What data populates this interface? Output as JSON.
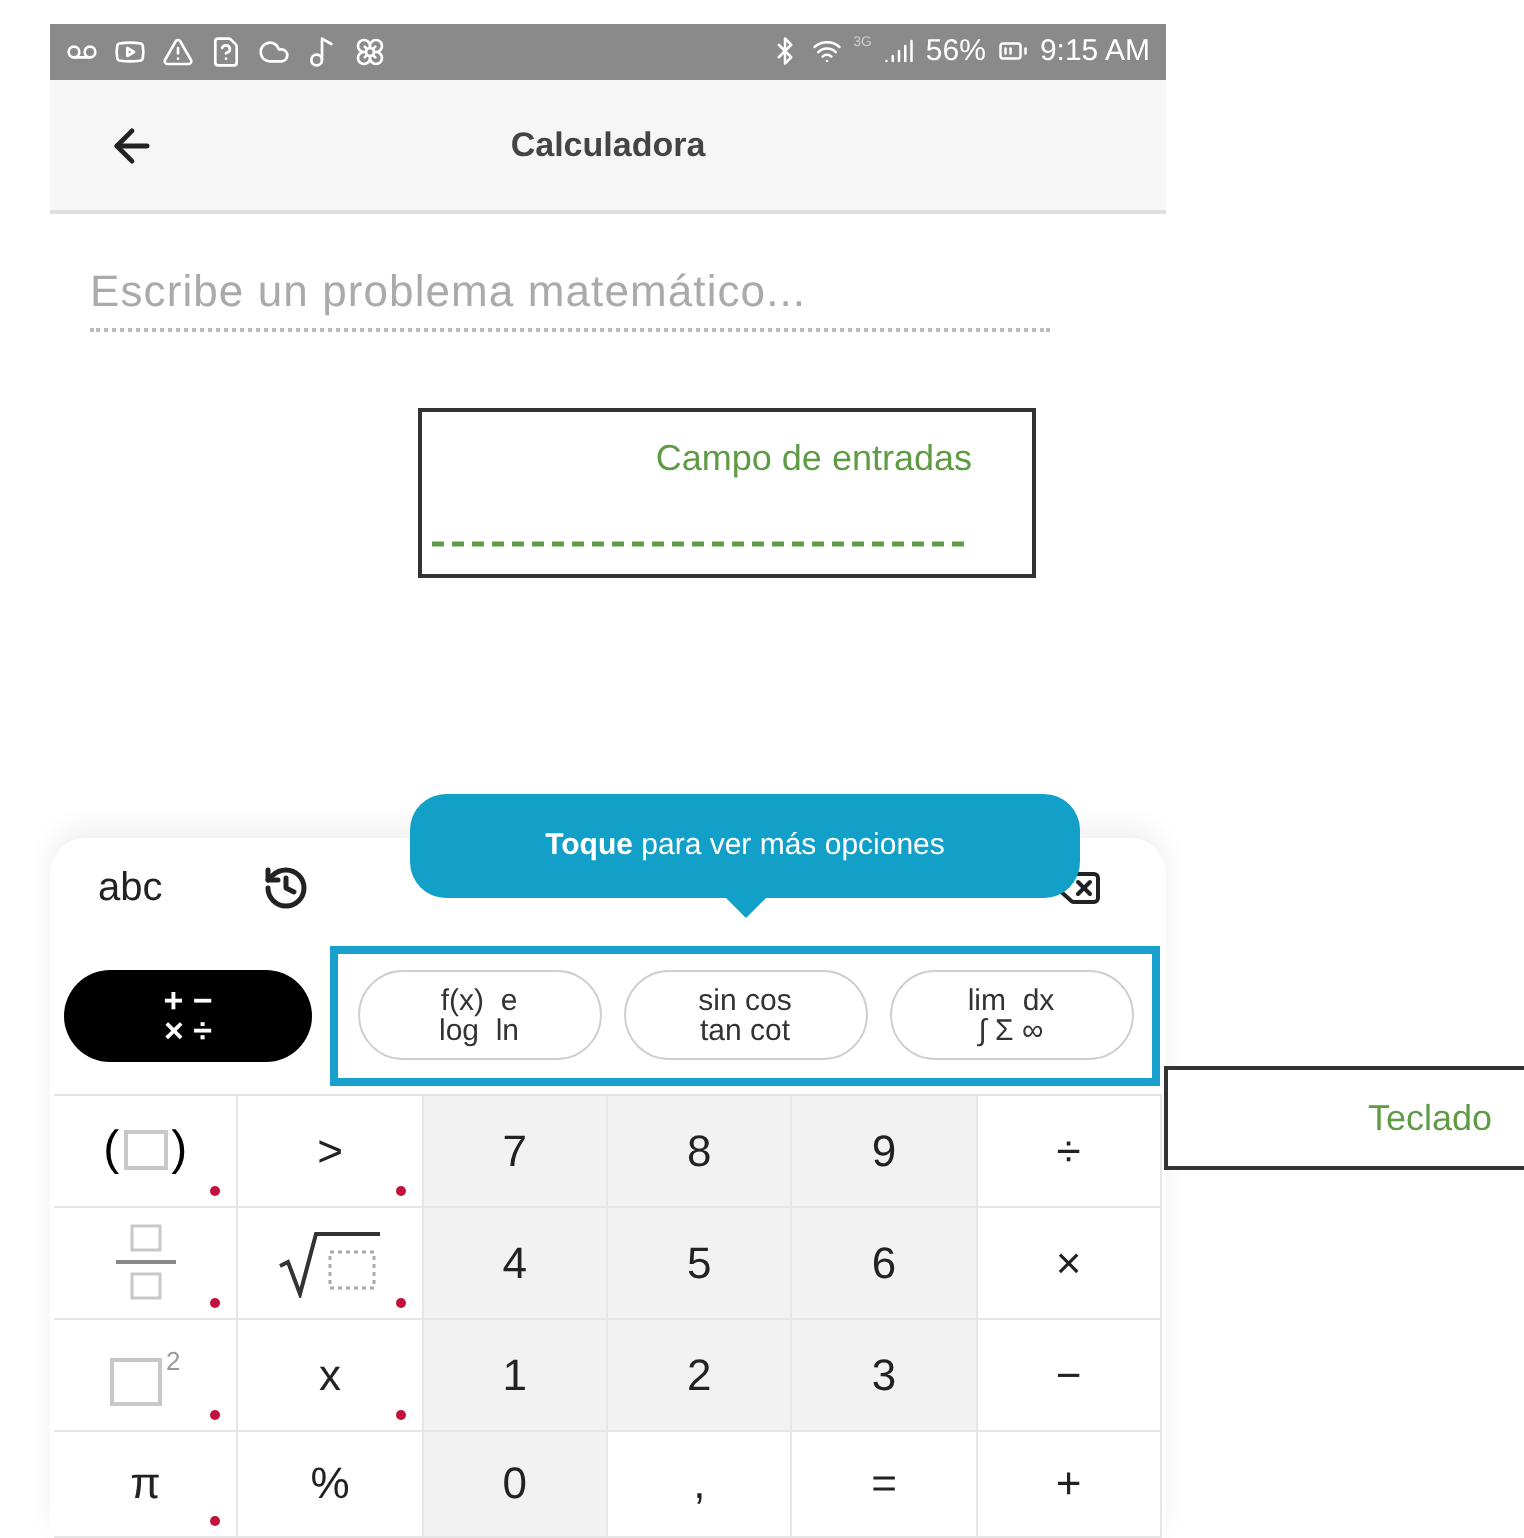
{
  "status_bar": {
    "battery": "56%",
    "time": "9:15 AM",
    "network": "3G"
  },
  "header": {
    "title": "Calculadora"
  },
  "input": {
    "placeholder": "Escribe un problema matemático..."
  },
  "keyboard": {
    "mode_tabs": [
      {
        "label": "abc"
      }
    ],
    "tooltip": "**Toque** para ver más opciones",
    "categories": [
      {
        "lines": [
          "+ −",
          "× ÷"
        ],
        "selected": true
      },
      {
        "lines": [
          "f(x)  e",
          "log  ln"
        ],
        "selected": false
      },
      {
        "lines": [
          "sin cos",
          "tan cot"
        ],
        "selected": false
      },
      {
        "lines": [
          "lim  dx",
          "∫ Σ ∞"
        ],
        "selected": false
      }
    ],
    "keys": [
      {
        "kind": "parens",
        "left": "(",
        "right": ")",
        "shaded": false,
        "more": true
      },
      {
        "kind": "text",
        "label": ">",
        "shaded": false,
        "more": true
      },
      {
        "kind": "text",
        "label": "7",
        "shaded": true,
        "more": false
      },
      {
        "kind": "text",
        "label": "8",
        "shaded": true,
        "more": false
      },
      {
        "kind": "text",
        "label": "9",
        "shaded": true,
        "more": false
      },
      {
        "kind": "text",
        "label": "÷",
        "shaded": false,
        "more": false
      },
      {
        "kind": "fraction",
        "shaded": false,
        "more": true
      },
      {
        "kind": "sqrt",
        "shaded": false,
        "more": true
      },
      {
        "kind": "text",
        "label": "4",
        "shaded": true,
        "more": false
      },
      {
        "kind": "text",
        "label": "5",
        "shaded": true,
        "more": false
      },
      {
        "kind": "text",
        "label": "6",
        "shaded": true,
        "more": false
      },
      {
        "kind": "text",
        "label": "×",
        "shaded": false,
        "more": false
      },
      {
        "kind": "power",
        "exponent": "2",
        "shaded": false,
        "more": true
      },
      {
        "kind": "text",
        "label": "x",
        "shaded": false,
        "more": true
      },
      {
        "kind": "text",
        "label": "1",
        "shaded": true,
        "more": false
      },
      {
        "kind": "text",
        "label": "2",
        "shaded": true,
        "more": false
      },
      {
        "kind": "text",
        "label": "3",
        "shaded": true,
        "more": false
      },
      {
        "kind": "text",
        "label": "−",
        "shaded": false,
        "more": false
      },
      {
        "kind": "text",
        "label": "π",
        "shaded": false,
        "more": true
      },
      {
        "kind": "text",
        "label": "%",
        "shaded": false,
        "more": false
      },
      {
        "kind": "text",
        "label": "0",
        "shaded": true,
        "more": false
      },
      {
        "kind": "text",
        "label": ",",
        "shaded": false,
        "more": false
      },
      {
        "kind": "text",
        "label": "=",
        "shaded": false,
        "more": false
      },
      {
        "kind": "text",
        "label": "+",
        "shaded": false,
        "more": false
      }
    ]
  },
  "annotations": [
    {
      "kind": "input",
      "text": "Campo de entradas"
    },
    {
      "kind": "keyboard",
      "text": "Teclado"
    }
  ]
}
